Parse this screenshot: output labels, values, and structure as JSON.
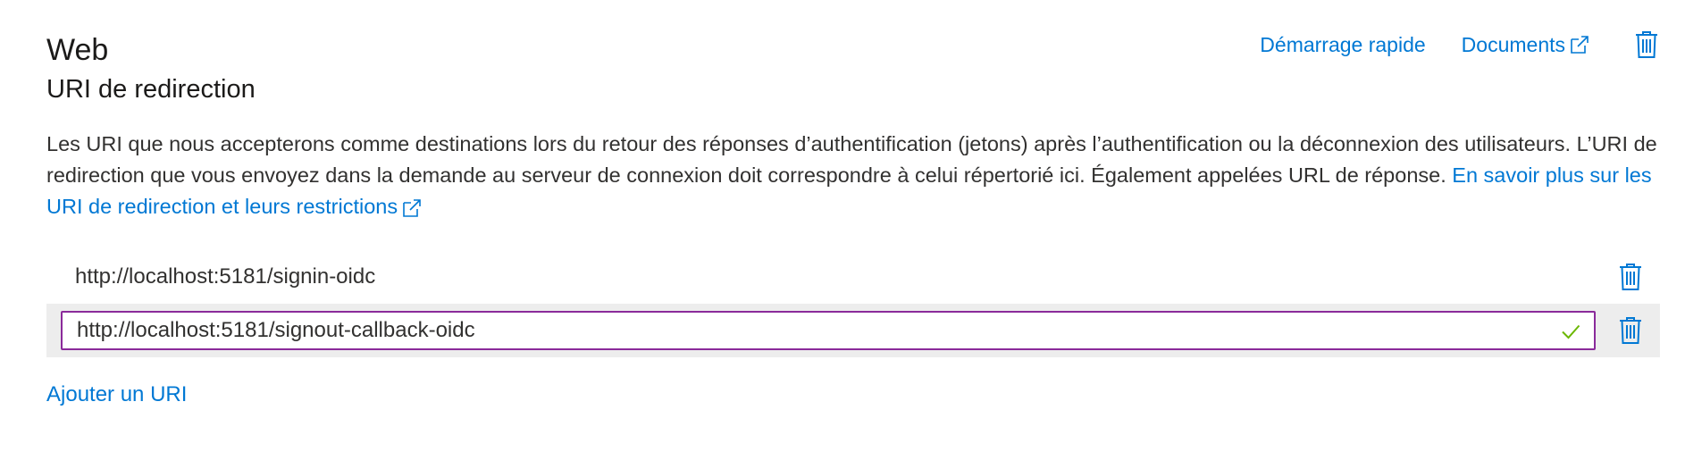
{
  "section": {
    "title": "Web",
    "subtitle": "URI de redirection"
  },
  "top_links": {
    "quickstart": "Démarrage rapide",
    "docs": "Documents"
  },
  "description": {
    "text": "Les URI que nous accepterons comme destinations lors du retour des réponses d’authentification (jetons) après l’authentification ou la déconnexion des utilisateurs. L’URI de redirection que vous envoyez dans la demande au serveur de connexion doit correspondre à celui répertorié ici. Également appelées URL de réponse. ",
    "link": "En savoir plus sur les URI de redirection et leurs restrictions"
  },
  "redirect_uris": [
    {
      "value": "http://localhost:5181/signin-oidc"
    },
    {
      "value": "http://localhost:5181/signout-callback-oidc"
    }
  ],
  "add_uri_label": "Ajouter un URI",
  "icons": {
    "trash": "trash-icon",
    "external": "external-link-icon",
    "check": "checkmark-icon"
  },
  "colors": {
    "link": "#0078d4",
    "input_border": "#8a2a9a",
    "check": "#6bb700",
    "row_highlight": "#ededed"
  }
}
